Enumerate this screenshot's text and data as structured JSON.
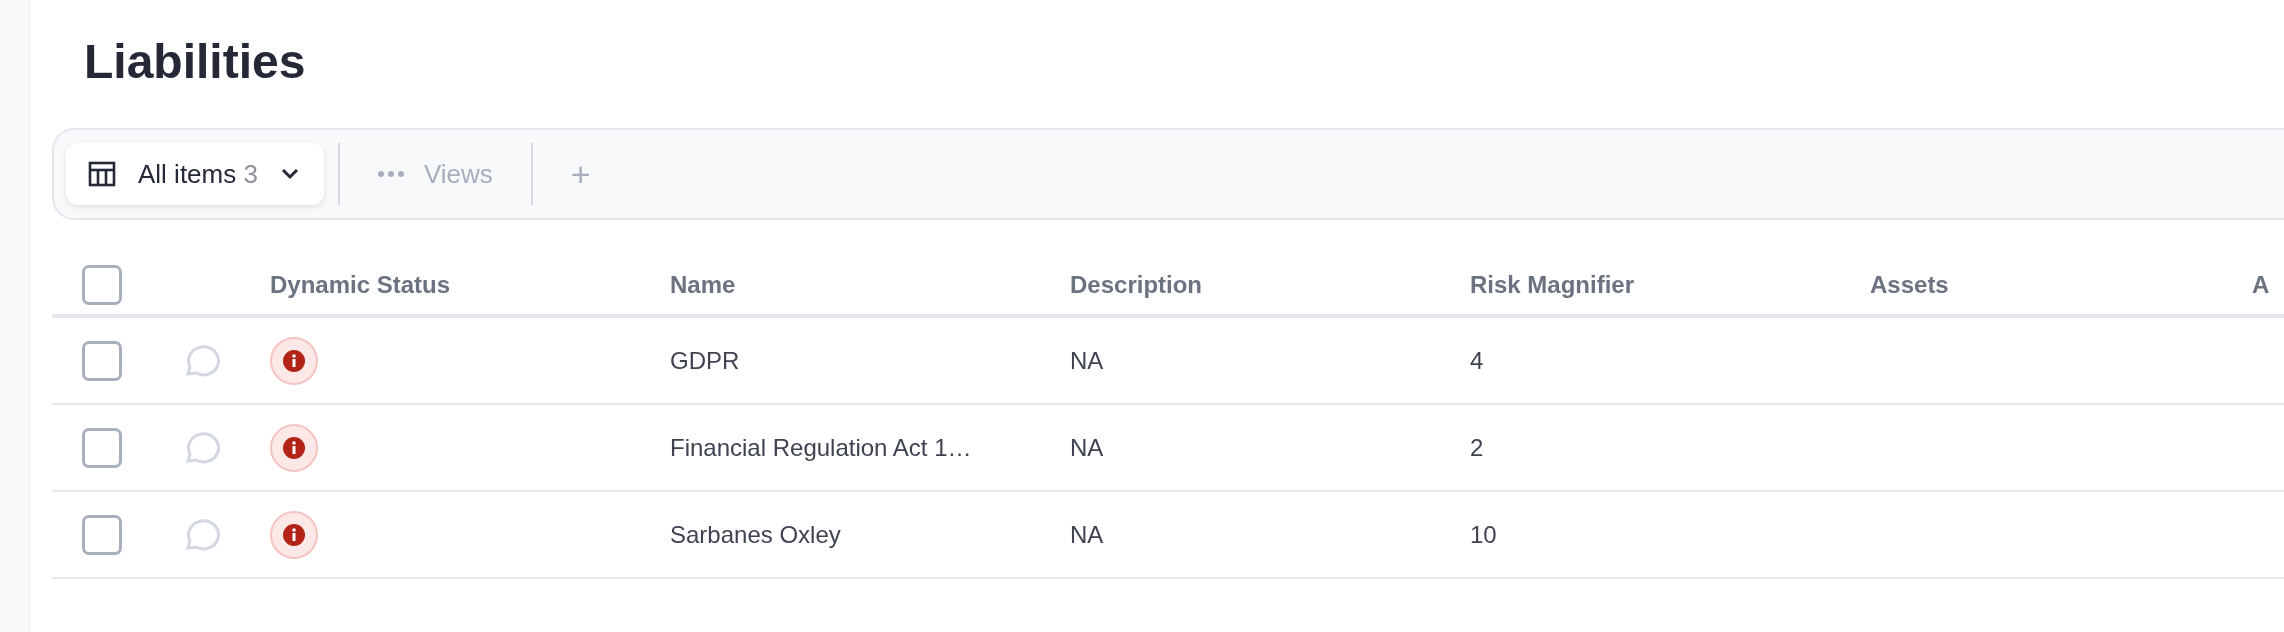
{
  "page_title": "Liabilities",
  "toolbar": {
    "view_button": {
      "label": "All items",
      "count": "3"
    },
    "views_button": {
      "label": "Views",
      "disabled": true
    },
    "add_button": {
      "label": "+"
    }
  },
  "table": {
    "select_all": {
      "checked": false
    },
    "columns": [
      "Dynamic Status",
      "Name",
      "Description",
      "Risk Magnifier",
      "Assets",
      "A"
    ],
    "rows": [
      {
        "checked": false,
        "color": "#b42318",
        "name": "GDPR",
        "description": "NA",
        "risk_magnifier": "4"
      },
      {
        "checked": false,
        "color": "#b42318",
        "name": "Financial Regulation Act 1…",
        "description": "NA",
        "risk_magnifier": "2"
      },
      {
        "checked": false,
        "color": "#b42318",
        "name": "Sarbanes Oxley",
        "description": "NA",
        "risk_magnifier": "10"
      }
    ]
  }
}
